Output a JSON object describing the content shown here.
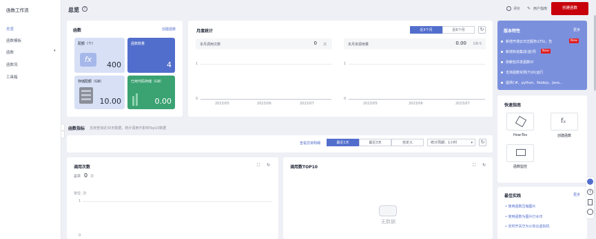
{
  "sidebar": {
    "title": "函数工作流",
    "items": [
      "总览",
      "函数模板",
      "函数",
      "函数流",
      "工具箱"
    ]
  },
  "header": {
    "title": "总览",
    "rate_label": "评价",
    "guide_label": "用户指南",
    "create_button": "创建函数"
  },
  "functions_panel": {
    "title": "函数",
    "create_link": "创建函数",
    "metrics": [
      {
        "label": "配额（个）",
        "value": "400"
      },
      {
        "label": "函数数量",
        "value": "4"
      },
      {
        "label": "存储配额（GB）",
        "value": "10.00"
      },
      {
        "label": "已用代码存储（GB）",
        "value": "0.00"
      }
    ]
  },
  "monthly": {
    "title": "月度统计",
    "tabs": [
      "近3个月",
      "近6个月"
    ],
    "calls": {
      "label": "本月调用次数",
      "value": "0",
      "unit": "次",
      "y_top": "1",
      "y_bottom": "0",
      "x_ticks": [
        "2023/05",
        "2023/06",
        "2023/07"
      ]
    },
    "resources": {
      "label": "本月资源用量",
      "value": "0.00",
      "unit": "GB-S",
      "y_top": "1",
      "y_bottom": "0",
      "x_ticks": [
        "2023/05",
        "2023/06",
        "2023/07"
      ]
    }
  },
  "metrics_section": {
    "title": "函数指标",
    "subtitle": "支持查询近30天数据，统计调用不影响Top10数据",
    "view_errors_link": "查看异常明细",
    "ranges": [
      "最近1天",
      "最近3天",
      "自定义"
    ],
    "period_label": "统计周期：1小时"
  },
  "calls_chart": {
    "title": "调用次数",
    "total_label": "总共",
    "total_value": "0",
    "total_unit": "次",
    "unit_label": "单位: 次",
    "y_top": "1",
    "y_bottom": "0"
  },
  "top10": {
    "title": "调用数TOP10",
    "empty_text": "无数据"
  },
  "version": {
    "title": "版本特性",
    "more": "更多",
    "new_badge": "New",
    "items": [
      "新增开通云日志服务(LTS)，告",
      "新增知道集成(首)导",
      "依赖包共享函数ID",
      "支持函数实例(T)(R)运行",
      "提供C#、python、Nodejs、Java..."
    ]
  },
  "quick_guide": {
    "title": "快速指南",
    "items": [
      "How-Tos",
      "创建函数",
      "函数监控"
    ]
  },
  "best_practice": {
    "title": "最佳实践",
    "more": "更多",
    "items": [
      "使用函数压缩图片",
      "使用函数为图片打水印",
      "定时开关华为公有云虚拟机"
    ]
  },
  "colors": {
    "accent": "#526ecc",
    "danger": "#c7000b",
    "metric_blue": "#526ecc",
    "metric_green": "#3ba272",
    "metric_gray": "#d7e0f5"
  }
}
